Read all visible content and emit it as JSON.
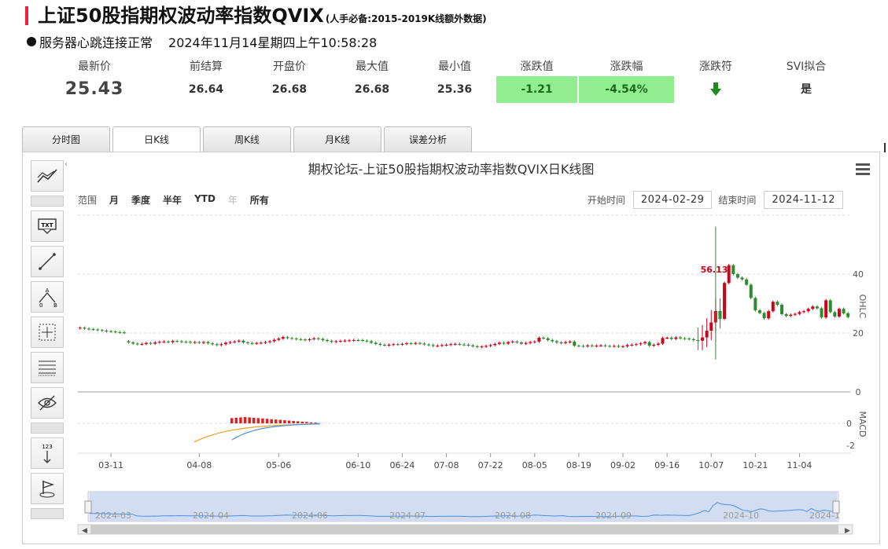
{
  "header": {
    "title": "上证50股指期权波动率指数QVIX",
    "subtitle": "(人手必备:2015-2019K线额外数据)",
    "status": "服务器心跳连接正常",
    "datetime": "2024年11月14星期四上午10:58:28"
  },
  "quote": {
    "latest_label": "最新价",
    "latest": "25.43",
    "prev_label": "前结算",
    "prev": "26.64",
    "open_label": "开盘价",
    "open": "26.68",
    "high_label": "最大值",
    "high": "26.68",
    "low_label": "最小值",
    "low": "25.36",
    "change_label": "涨跌值",
    "change": "-1.21",
    "pct_label": "涨跌幅",
    "pct": "-4.54%",
    "sign_label": "涨跌符",
    "sign_icon": "arrow-down-icon",
    "svi_label": "SVI拟合",
    "svi": "是",
    "down_color": "#90ee90"
  },
  "tabs": [
    "分时图",
    "日K线",
    "周K线",
    "月K线",
    "误差分析"
  ],
  "range": {
    "label": "范围",
    "buttons": [
      "月",
      "季度",
      "半年",
      "YTD",
      "年",
      "所有"
    ],
    "start_label": "开始时间",
    "start": "2024-02-29",
    "end_label": "结束时间",
    "end": "2024-11-12"
  },
  "chart_data": {
    "type": "candlestick",
    "title": "期权论坛-上证50股指期权波动率指数QVIX日K线图",
    "price_axis_label": "OHLC",
    "macd_axis_label": "MACD",
    "price_ticks": [
      "40",
      "20",
      "0"
    ],
    "price_tick_values": [
      40,
      20,
      0
    ],
    "price_ylim": [
      0,
      60
    ],
    "macd_ticks": [
      "0",
      "-2"
    ],
    "x_tick_labels": [
      "03-11",
      "04-08",
      "05-06",
      "06-10",
      "06-24",
      "07-08",
      "07-22",
      "08-05",
      "08-19",
      "09-02",
      "09-16",
      "10-07",
      "10-21",
      "11-04"
    ],
    "x_tick_index": [
      7,
      27,
      45,
      63,
      73,
      83,
      93,
      103,
      113,
      123,
      133,
      143,
      153,
      163
    ],
    "annotation": "56.13",
    "annotation_index": 142,
    "candle_count": 171,
    "up_color": "#d0021b",
    "down_color": "#2e8b2e",
    "navigator_labels": [
      "2024-03",
      "2024-04",
      "2024-06",
      "2024-07",
      "2024-08",
      "2024-09",
      "2024-10",
      "2024-1"
    ],
    "closes": [
      21.8,
      21.5,
      21.3,
      21.2,
      21.0,
      20.8,
      20.6,
      20.5,
      20.3,
      20.2,
      20.1,
      16.8,
      16.4,
      16.2,
      16.3,
      16.6,
      16.4,
      16.8,
      17.0,
      17.1,
      16.9,
      17.3,
      17.2,
      17.0,
      17.0,
      16.8,
      16.9,
      16.7,
      16.9,
      16.5,
      16.2,
      15.9,
      16.2,
      16.7,
      16.9,
      17.1,
      17.4,
      16.8,
      16.6,
      16.5,
      16.6,
      16.7,
      16.9,
      17.2,
      17.7,
      18.1,
      18.6,
      18.3,
      18.1,
      17.9,
      17.8,
      17.6,
      17.9,
      18.2,
      18.0,
      17.6,
      17.3,
      17.0,
      17.2,
      17.3,
      17.4,
      17.5,
      17.6,
      17.6,
      17.4,
      17.2,
      16.7,
      16.3,
      16.0,
      15.9,
      16.0,
      16.2,
      16.1,
      16.3,
      16.5,
      16.4,
      16.6,
      16.4,
      16.1,
      15.9,
      15.6,
      15.7,
      15.9,
      16.0,
      16.2,
      16.3,
      16.1,
      16.0,
      15.8,
      15.5,
      15.3,
      15.4,
      15.6,
      15.9,
      16.3,
      16.7,
      16.4,
      16.9,
      17.1,
      16.8,
      16.4,
      16.6,
      16.9,
      17.1,
      18.4,
      18.2,
      17.6,
      17.2,
      16.8,
      16.6,
      16.9,
      17.1,
      15.7,
      15.6,
      15.5,
      15.8,
      15.6,
      15.7,
      15.8,
      15.6,
      15.5,
      15.6,
      15.4,
      15.5,
      15.9,
      16.0,
      16.2,
      16.5,
      16.9,
      15.7,
      16.0,
      16.4,
      18.3,
      18.4,
      18.0,
      18.5,
      18.2,
      18.1,
      17.9,
      17.6,
      17.4,
      18.5,
      20.8,
      23.6,
      27.5,
      24.8,
      37.0,
      43.0,
      40.0,
      38.8,
      38.2,
      36.4,
      31.9,
      27.7,
      26.8,
      25.0,
      27.4,
      30.6,
      29.6,
      26.4,
      25.8,
      26.2,
      26.5,
      27.1,
      27.4,
      28.2,
      29.0,
      28.4,
      25.3,
      31.1,
      27.1,
      25.6,
      28.2,
      26.7,
      25.4
    ],
    "opens": [
      21.6,
      21.8,
      21.5,
      21.3,
      21.2,
      21.0,
      20.8,
      20.6,
      20.5,
      20.3,
      20.2,
      17.2,
      16.8,
      16.4,
      16.2,
      16.3,
      16.6,
      16.4,
      16.8,
      17.0,
      17.1,
      16.9,
      17.3,
      17.2,
      17.0,
      17.0,
      16.8,
      16.9,
      16.7,
      16.9,
      16.5,
      16.2,
      15.9,
      16.2,
      16.7,
      16.9,
      17.1,
      17.4,
      16.8,
      16.6,
      16.5,
      16.6,
      16.7,
      16.9,
      17.2,
      17.7,
      18.1,
      18.6,
      18.3,
      18.1,
      17.9,
      17.8,
      17.6,
      17.9,
      18.2,
      18.0,
      17.6,
      17.3,
      17.0,
      17.2,
      17.3,
      17.4,
      17.5,
      17.6,
      17.6,
      17.4,
      17.2,
      16.7,
      16.3,
      16.0,
      15.9,
      16.0,
      16.2,
      16.1,
      16.3,
      16.5,
      16.4,
      16.6,
      16.4,
      16.1,
      15.9,
      15.6,
      15.7,
      15.9,
      16.0,
      16.2,
      16.3,
      16.1,
      16.0,
      15.8,
      15.5,
      15.3,
      15.4,
      15.6,
      15.9,
      16.3,
      16.7,
      16.4,
      16.9,
      17.1,
      16.8,
      16.4,
      16.6,
      16.9,
      17.1,
      18.4,
      18.2,
      17.6,
      17.2,
      16.8,
      16.6,
      16.9,
      17.1,
      15.7,
      15.6,
      15.5,
      15.8,
      15.6,
      15.7,
      15.8,
      15.6,
      15.5,
      15.6,
      15.4,
      15.5,
      15.9,
      16.0,
      16.2,
      16.5,
      16.9,
      15.7,
      16.0,
      16.4,
      18.3,
      18.4,
      18.0,
      18.5,
      18.2,
      18.1,
      17.9,
      17.6,
      17.4,
      18.5,
      20.8,
      23.6,
      27.5,
      24.8,
      37.0,
      43.0,
      40.0,
      38.8,
      38.2,
      36.4,
      31.9,
      27.7,
      26.8,
      25.0,
      27.4,
      30.6,
      29.6,
      26.4,
      25.8,
      26.2,
      26.5,
      27.1,
      27.4,
      28.2,
      29.0,
      28.4,
      25.3,
      31.1,
      27.1,
      25.6,
      28.2,
      26.7
    ]
  }
}
